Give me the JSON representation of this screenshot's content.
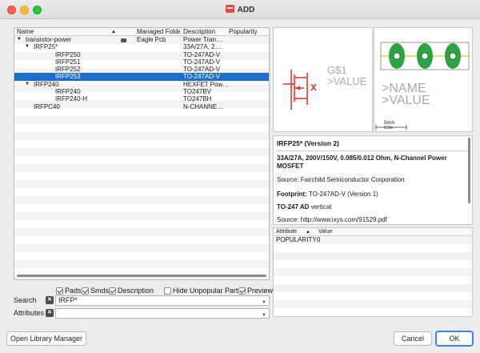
{
  "window": {
    "title": "ADD"
  },
  "tree": {
    "columns": [
      "Name",
      "▲",
      "Managed Folde",
      "Description",
      "Popularity"
    ],
    "rows": [
      {
        "expander": "▼",
        "name": "transistor-power",
        "lock": true,
        "managed": "Eagle Pcb",
        "desc": "Power Tran…",
        "indent": 0
      },
      {
        "expander": "▼",
        "name": "IRFP25*",
        "lock": false,
        "managed": "",
        "desc": "33A/27A, 2…",
        "indent": 1
      },
      {
        "expander": "",
        "name": "IRFP250",
        "lock": false,
        "managed": "",
        "desc": "TO-247AD-V",
        "indent": 2
      },
      {
        "expander": "",
        "name": "IRFP251",
        "lock": false,
        "managed": "",
        "desc": "TO-247AD-V",
        "indent": 2
      },
      {
        "expander": "",
        "name": "IRFP252",
        "lock": false,
        "managed": "",
        "desc": "TO-247AD-V",
        "indent": 2
      },
      {
        "expander": "",
        "name": "IRFP253",
        "lock": false,
        "managed": "",
        "desc": "TO-247AD-V",
        "indent": 2,
        "selected": true
      },
      {
        "expander": "▼",
        "name": "IRFP240",
        "lock": false,
        "managed": "",
        "desc": "HEXFET Pow…",
        "indent": 1
      },
      {
        "expander": "",
        "name": "IRFP240",
        "lock": false,
        "managed": "",
        "desc": "TO247BV",
        "indent": 2
      },
      {
        "expander": "",
        "name": "IRFP240-H",
        "lock": false,
        "managed": "",
        "desc": "TO247BH",
        "indent": 2
      },
      {
        "expander": "",
        "name": "IRFPC40",
        "lock": false,
        "managed": "",
        "desc": "N-CHANNE…",
        "indent": 1
      }
    ]
  },
  "filters": {
    "pads": "Pads",
    "smds": "Smds",
    "description": "Description",
    "hide_unpopular": "Hide Unpopular Parts",
    "preview": "Preview"
  },
  "search": {
    "label": "Search",
    "value": "IRFP*"
  },
  "attributes": {
    "label": "Attributes",
    "value": ""
  },
  "symbol": {
    "gate_name": "G$1",
    "value_text": ">VALUE"
  },
  "package": {
    "name_text": ">NAME",
    "value_text": ">VALUE",
    "scale": "5mm",
    "scale2": "0.2in"
  },
  "detail": {
    "heading": "IRFP25* (Version 2)",
    "summary": "33A/27A, 200V/150V, 0.085/0.012 Ohm, N-Channel Power MOSFET",
    "source": "Source: Fairchild Semiconductor Corporation",
    "footprint_label": "Footprint:",
    "footprint_value": "TO-247AD-V (Version 1)",
    "pkg_bold": "TO-247 AD",
    "pkg_rest": "vertical",
    "source2": "Source: http://www.ixys.com/91529.pdf"
  },
  "attr_table": {
    "col1": "Attribute",
    "sort": "▲",
    "col2": "Value",
    "rows": [
      {
        "name": "POPULARITY",
        "value": "0"
      }
    ]
  },
  "buttons": {
    "open_library": "Open Library Manager",
    "cancel": "Cancel",
    "ok": "OK"
  },
  "colors": {
    "selection": "#1c6ec9",
    "pad_green": "#2fa043",
    "symbol_red": "#d93a2e"
  }
}
